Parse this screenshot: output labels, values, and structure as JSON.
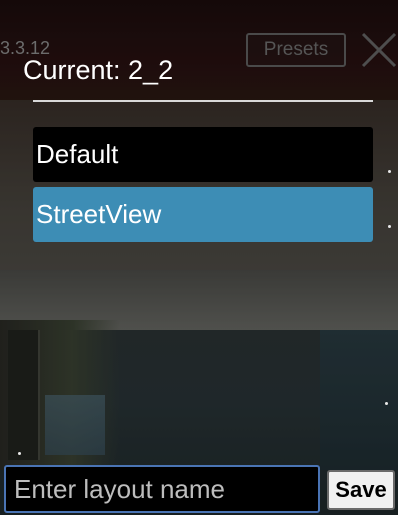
{
  "header": {
    "version": "3.3.12",
    "presets_label": "Presets",
    "close_icon": "close-icon"
  },
  "menu": {
    "current_label": "Current: 2_2",
    "items": [
      {
        "label": "Default",
        "selected": false
      },
      {
        "label": "StreetView",
        "selected": true
      }
    ],
    "selected_color": "#3d8db5",
    "item_color": "#000000"
  },
  "footer": {
    "input_placeholder": "Enter layout name",
    "input_value": "",
    "save_label": "Save"
  }
}
